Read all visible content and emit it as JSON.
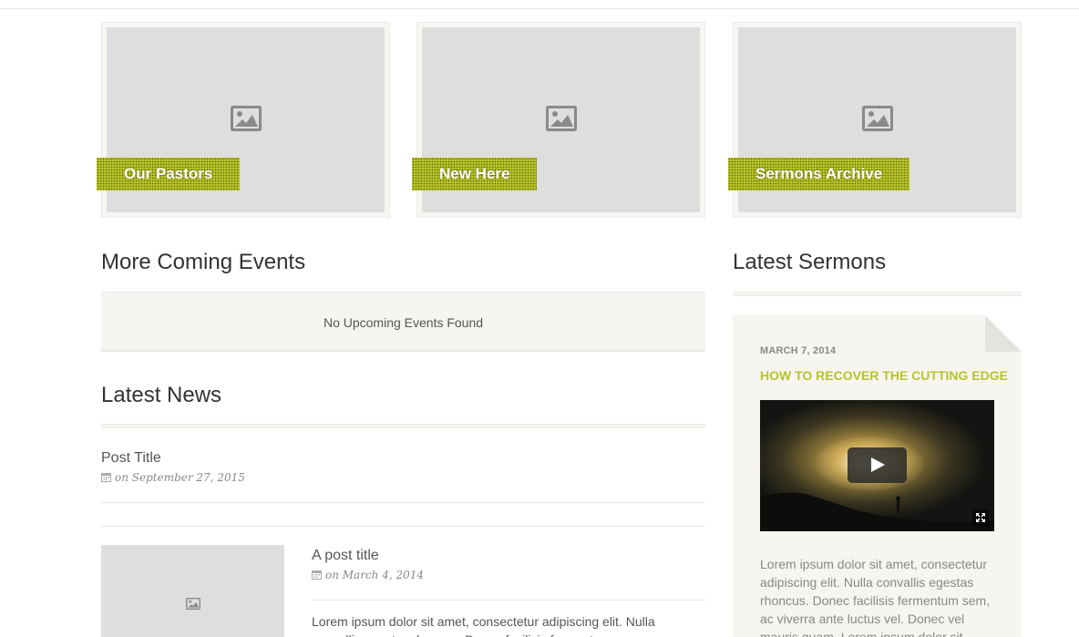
{
  "features": [
    {
      "label": "Our Pastors"
    },
    {
      "label": "New Here"
    },
    {
      "label": "Sermons Archive"
    }
  ],
  "events": {
    "heading": "More Coming Events",
    "empty_message": "No Upcoming Events Found"
  },
  "news": {
    "heading": "Latest News",
    "posts": [
      {
        "title": "Post Title",
        "meta": "on September 27, 2015"
      },
      {
        "title": "A post title",
        "meta": "on March 4, 2014",
        "excerpt": "Lorem ipsum dolor sit amet, consectetur adipiscing elit. Nulla convallis egestas rhoncus. Donec facilisis fermentum sem, ac viverra"
      }
    ]
  },
  "sermons": {
    "heading": "Latest Sermons",
    "item": {
      "date": "MARCH 7, 2014",
      "title": "HOW TO RECOVER THE CUTTING EDGE",
      "excerpt": "Lorem ipsum dolor sit amet, consectetur adipiscing elit. Nulla convallis egestas rhoncus. Donec facilisis fermentum sem, ac viverra ante luctus vel. Donec vel mauris quam. Lorem ipsum dolor sit"
    }
  },
  "colors": {
    "accent": "#b8c426",
    "placeholder": "#dedede",
    "panel": "#f6f5f1"
  },
  "icons": {
    "image_placeholder": "image-icon",
    "calendar": "calendar-icon",
    "play": "play-icon",
    "fullscreen": "fullscreen-icon"
  }
}
